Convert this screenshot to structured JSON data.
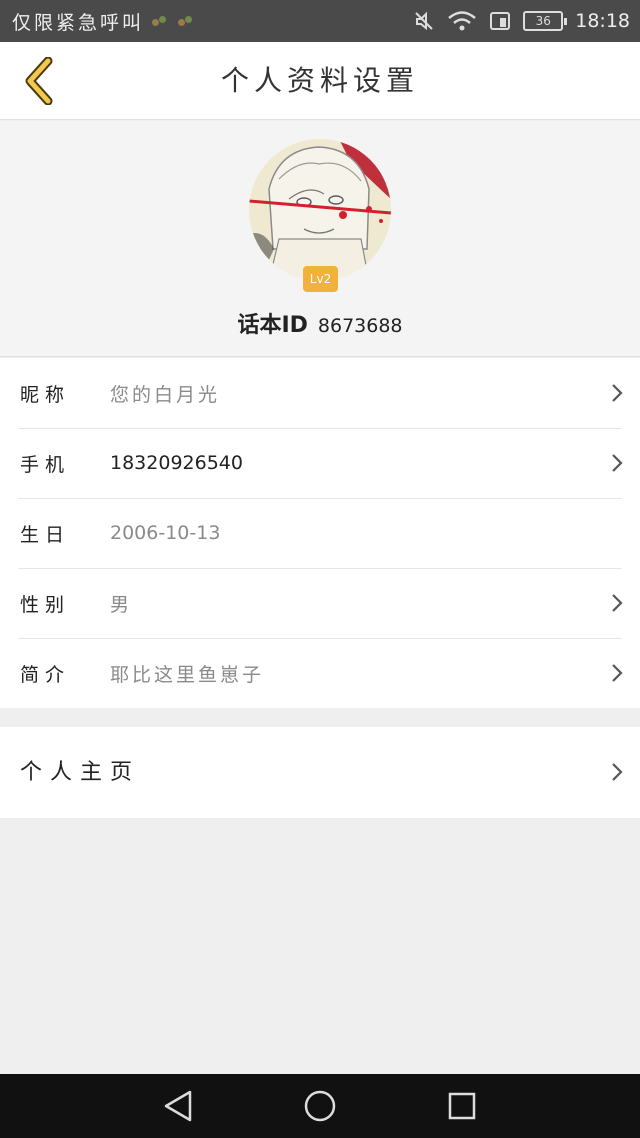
{
  "status_bar": {
    "carrier_text": "仅限紧急呼叫",
    "time": "18:18",
    "battery": "36",
    "icons": [
      "mute-icon",
      "wifi-icon",
      "sim-icon",
      "battery-icon"
    ]
  },
  "header": {
    "title": "个人资料设置",
    "back_icon": "chevron-left-icon",
    "accent_color": "#f2b13a"
  },
  "profile": {
    "level": "Lv2",
    "id_label": "话本ID",
    "id_value": "8673688"
  },
  "fields": [
    {
      "label": "昵称",
      "value": "您的白月光",
      "editable": true
    },
    {
      "label": "手机",
      "value": "18320926540",
      "editable": true
    },
    {
      "label": "生日",
      "value": "2006-10-13",
      "editable": false
    },
    {
      "label": "性别",
      "value": "男",
      "editable": true
    },
    {
      "label": "简介",
      "value": "耶比这里鱼崽子",
      "editable": true
    }
  ],
  "homepage": {
    "label": "个人主页"
  },
  "nav_bar": {
    "icons": [
      "back-triangle-icon",
      "home-circle-icon",
      "recents-square-icon"
    ]
  }
}
